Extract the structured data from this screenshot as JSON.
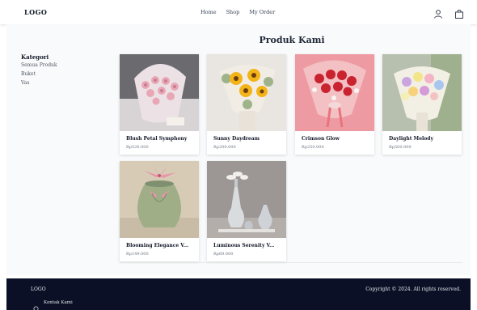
{
  "navbar": {
    "logo": "LOGO",
    "links": [
      "Home",
      "Shop",
      "My Order"
    ],
    "icons": [
      "user-icon",
      "shopping-bag-icon"
    ]
  },
  "sidebar": {
    "heading": "Kategori",
    "items": [
      "Semua Produk",
      "Buket",
      "Vas"
    ]
  },
  "main": {
    "title": "Produk Kami",
    "products": [
      {
        "name": "Blush Petal Symphony",
        "price": "Rp526.000"
      },
      {
        "name": "Sunny Daydream",
        "price": "Rp200.000"
      },
      {
        "name": "Crimson Glow",
        "price": "Rp250.000"
      },
      {
        "name": "Daylight Melody",
        "price": "Rp500.000"
      },
      {
        "name": "Blooming Elegance V...",
        "price": "Rp149.000"
      },
      {
        "name": "Luminous Serenity V...",
        "price": "Rp69.000"
      }
    ]
  },
  "footer": {
    "logo": "LOGO",
    "contact": "Kontak Kami",
    "contact_icon": "whatsapp-icon",
    "copyright": "Copyright © 2024. All rights reserved."
  },
  "colors": {
    "footer_bg": "#0b1026",
    "content_bg": "#f9fafb"
  }
}
